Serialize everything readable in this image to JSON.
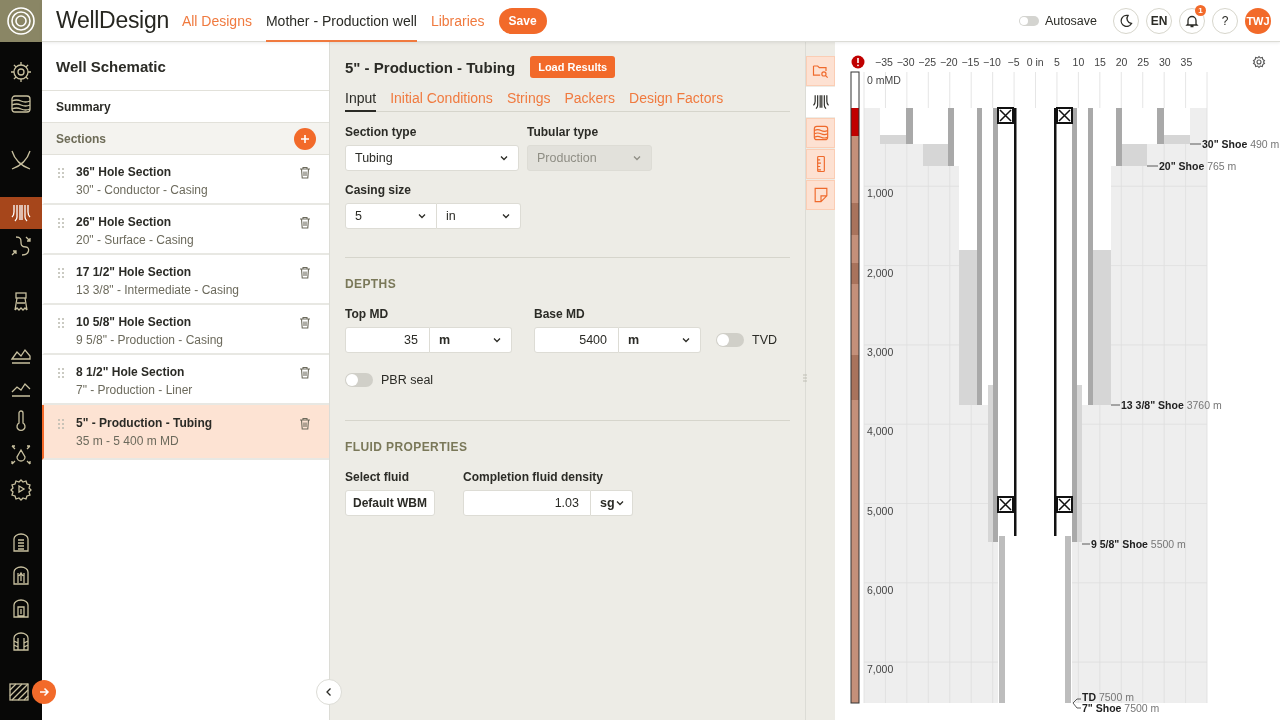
{
  "app": {
    "title": "WellDesign"
  },
  "rail": {
    "items": [
      {
        "selected": false
      },
      {
        "selected": false
      },
      {
        "selected": false
      },
      {
        "selected": true
      },
      {
        "selected": false
      },
      {
        "selected": false
      },
      {
        "selected": false
      },
      {
        "selected": false
      },
      {
        "selected": false
      },
      {
        "selected": false
      },
      {
        "selected": false
      },
      {
        "selected": false
      },
      {
        "selected": false
      },
      {
        "selected": false
      },
      {
        "selected": false
      },
      {
        "selected": false
      }
    ]
  },
  "nav": [
    {
      "label": "All Designs",
      "selected": false
    },
    {
      "label": "Mother - Production well",
      "selected": true
    },
    {
      "label": "Libraries",
      "selected": false
    }
  ],
  "save_button": "Save",
  "autosave": {
    "label": "Autosave",
    "on": false
  },
  "language": "EN",
  "notifications": {
    "count": "1"
  },
  "help": "?",
  "user": {
    "initials": "TWJ"
  },
  "sidebar": {
    "title": "Well Schematic",
    "summary": "Summary",
    "sections_label": "Sections",
    "sections": [
      {
        "title": "36\" Hole Section",
        "subtitle": "30\" - Conductor - Casing",
        "selected": false
      },
      {
        "title": "26\" Hole Section",
        "subtitle": "20\" - Surface - Casing",
        "selected": false
      },
      {
        "title": "17 1/2\" Hole Section",
        "subtitle": "13 3/8\" - Intermediate - Casing",
        "selected": false
      },
      {
        "title": "10 5/8\" Hole Section",
        "subtitle": "9 5/8\" - Production - Casing",
        "selected": false
      },
      {
        "title": "8 1/2\" Hole Section",
        "subtitle": "7\" - Production - Liner",
        "selected": false
      },
      {
        "title": "5\" - Production - Tubing",
        "subtitle": "35 m - 5 400 m MD",
        "selected": true
      }
    ]
  },
  "form": {
    "title": "5\" - Production - Tubing",
    "load_results": "Load Results",
    "tabs": [
      {
        "label": "Input",
        "selected": true
      },
      {
        "label": "Initial Conditions",
        "selected": false
      },
      {
        "label": "Strings",
        "selected": false
      },
      {
        "label": "Packers",
        "selected": false
      },
      {
        "label": "Design Factors",
        "selected": false
      }
    ],
    "section_type": {
      "label": "Section type",
      "value": "Tubing",
      "disabled": false
    },
    "tubular_type": {
      "label": "Tubular type",
      "value": "Production",
      "disabled": true
    },
    "casing_size": {
      "label": "Casing size",
      "value": "5",
      "unit": "in"
    },
    "depths": {
      "heading": "DEPTHS",
      "top_md": {
        "label": "Top MD",
        "value": "35",
        "unit": "m"
      },
      "base_md": {
        "label": "Base MD",
        "value": "5400",
        "unit": "m"
      },
      "tvd": {
        "label": "TVD",
        "on": false
      },
      "pbr_seal": {
        "label": "PBR seal",
        "on": false
      }
    },
    "fluid": {
      "heading": "FLUID PROPERTIES",
      "select_fluid": {
        "label": "Select fluid",
        "value": "Default WBM"
      },
      "density": {
        "label": "Completion fluid density",
        "value": "1.03",
        "unit": "sg"
      }
    }
  },
  "view_tabs": [
    {
      "selected": false
    },
    {
      "selected": true
    },
    {
      "selected": false
    },
    {
      "selected": false
    },
    {
      "selected": false
    }
  ],
  "schematic": {
    "x_ticks": [
      "−35",
      "−30",
      "−25",
      "−20",
      "−15",
      "−10",
      "−5",
      "0 in",
      "5",
      "10",
      "15",
      "20",
      "25",
      "30",
      "35"
    ],
    "depth_labels": [
      "0 mMD",
      "1,000",
      "2,000",
      "3,000",
      "4,000",
      "5,000",
      "6,000",
      "7,000"
    ],
    "shoes": [
      {
        "name": "30\" Shoe",
        "depth": "490 m"
      },
      {
        "name": "20\" Shoe",
        "depth": "765 m"
      },
      {
        "name": "13 3/8\" Shoe",
        "depth": "3760 m"
      },
      {
        "name": "9 5/8\" Shoe",
        "depth": "5500 m"
      },
      {
        "name": "7\" Shoe",
        "depth": "7500 m"
      }
    ],
    "td": {
      "name": "TD",
      "depth": "7500 m"
    }
  }
}
